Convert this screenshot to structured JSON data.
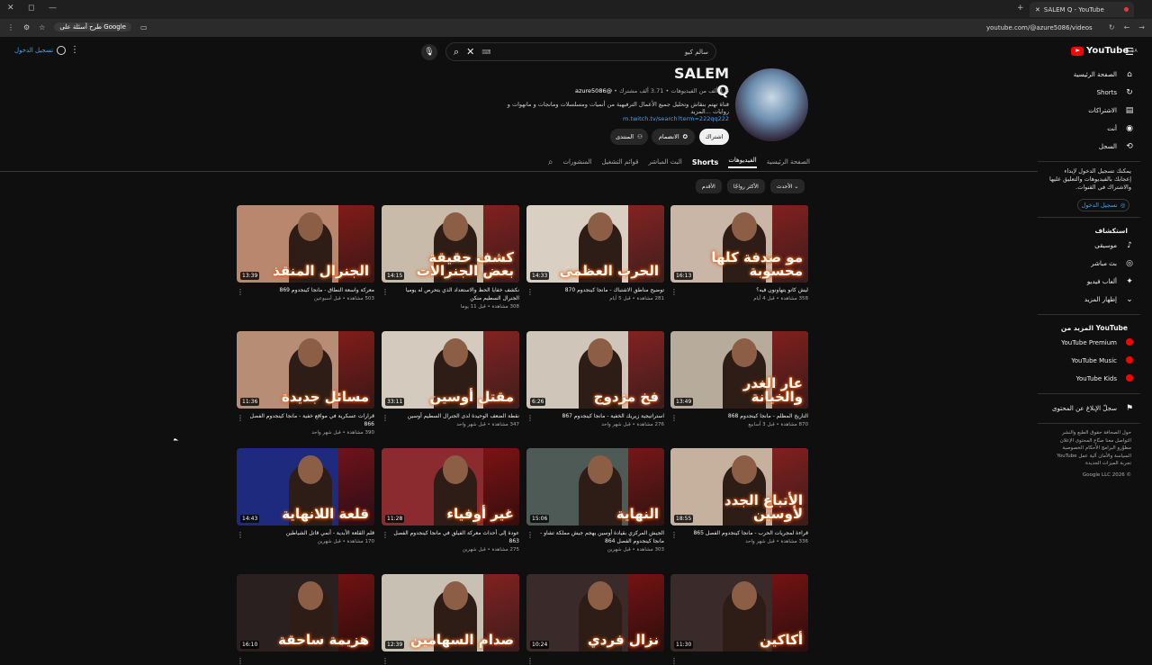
{
  "browser": {
    "tab_title": "SALEM Q - YouTube",
    "url": "youtube.com/@azure5086/videos",
    "ask_google_label": "طرح أسئلة على Google"
  },
  "header": {
    "signin_label": "تسجيل الدخول",
    "search_query": "سالم كيو",
    "logo_text": "YouTube",
    "logo_region": "SA"
  },
  "channel": {
    "name": "SALEM Q",
    "handle": "@azure5086",
    "subscribers": "3.71 ألف مشترك",
    "videos_count": "1.6 ألف من الفيديوهات",
    "description": "قناة تهتم بنقاش وتحليل جميع الأعمال الترفيهية من أنميات ومسلسلات ومانجات و مانهوات و روايات ...المزيد",
    "link": "m.twitch.tv/search?term=222qq222",
    "subscribe_label": "اشتراك",
    "join_label": "الانضمام",
    "community_label": "المنتدى"
  },
  "tabs": [
    "الصفحة الرئيسية",
    "الفيديوهات",
    "Shorts",
    "البث المباشر",
    "قوائم التشغيل",
    "المنشورات"
  ],
  "chips": [
    "الأحدث",
    "الأكثر رواجًا",
    "الأقدم"
  ],
  "sidebar": {
    "main": [
      {
        "label": "الصفحة الرئيسية",
        "icon": "⌂"
      },
      {
        "label": "Shorts",
        "icon": "↻"
      },
      {
        "label": "الاشتراكات",
        "icon": "▤"
      },
      {
        "label": "أنت",
        "icon": "◉"
      },
      {
        "label": "السجل",
        "icon": "⟲"
      }
    ],
    "signin_note": "يمكنك تسجيل الدخول لإبداء إعجابك بالفيديوهات والتعليق عليها والاشتراك في القنوات.",
    "signin_label": "تسجيل الدخول",
    "explore_title": "استكشاف",
    "explore": [
      {
        "label": "موسيقى",
        "icon": "♪"
      },
      {
        "label": "بث مباشر",
        "icon": "◎"
      },
      {
        "label": "ألعاب فيديو",
        "icon": "✦"
      },
      {
        "label": "إظهار المزيد",
        "icon": "⌄"
      }
    ],
    "more_title": "المزيد من YouTube",
    "more": [
      "YouTube Premium",
      "YouTube Music",
      "YouTube Kids"
    ],
    "report_label": "سجلّ الإبلاغ عن المحتوى",
    "footer": "حول   الصحافة   حقوق الطبع والنشر   التواصل معنا   صنّاع المحتوى   الإعلان   مطوّرو البرامج   الأحكام   الخصوصية   السياسة والأمان   آلية عمل YouTube   تجربة الميزات الجديدة",
    "copyright": "© 2026 Google LLC"
  },
  "videos": [
    {
      "overlay": "مو صدفة كلها محسوبة",
      "duration": "16:13",
      "title": "ليش كانو يتهاونون فيه؟",
      "stats": "358 مشاهدة • قبل 4 أيام",
      "bg": "#c9b6a6"
    },
    {
      "overlay": "الحرب العظمى",
      "duration": "14:33",
      "title": "توضيح مناطق الاشتباك - مانجا كينجدوم 870",
      "stats": "281 مشاهدة • قبل 5 أيام",
      "bg": "#d9cfc2"
    },
    {
      "overlay": "كشف حقيقة بعض الجنرالات",
      "duration": "14:15",
      "title": "نكشف خفايا الحظ والاستعداد الذي يتحرص له يوميا الجنرال السطيم منكن",
      "stats": "308 مشاهدة • قبل 11 يوما",
      "bg": "#c8bba9"
    },
    {
      "overlay": "الجنرال المنقذ",
      "duration": "13:39",
      "title": "معركة واسعة النطاق - مانجا كينجدوم 869",
      "stats": "503 مشاهدة • قبل أسبوعين",
      "bg": "#b9876e"
    },
    {
      "overlay": "عار الغدر والخيانة",
      "duration": "13:49",
      "title": "التاريخ المظلم - مانجا كينجدوم 868",
      "stats": "870 مشاهدة • قبل 3 أسابيع",
      "bg": "#b7ab9b"
    },
    {
      "overlay": "فخ مزدوج",
      "duration": "6:26",
      "title": "استراتيجية زيريك الخفية - مانجا كينجدوم 867",
      "stats": "276 مشاهدة • قبل شهر واحد",
      "bg": "#cfc5b8"
    },
    {
      "overlay": "مقتل أوسين",
      "duration": "33:11",
      "title": "نقطة الضعف الوحيدة لدى الجنرال السطيم أوسين",
      "stats": "347 مشاهدة • قبل شهر واحد",
      "bg": "#d4cabd"
    },
    {
      "overlay": "مسائل جديدة",
      "duration": "11:36",
      "title": "قرارات عسكرية في مواقع خفية - مانجا كينجدوم الفصل 866",
      "stats": "390 مشاهدة • قبل شهر واحد",
      "bg": "#b88d76"
    },
    {
      "overlay": "الأتباع الجدد لأوسين",
      "duration": "18:55",
      "title": "قراءة لمجريات الحرب - مانجا كينجدوم الفصل 865",
      "stats": "336 مشاهدة • قبل شهر واحد",
      "bg": "#c6b19f"
    },
    {
      "overlay": "النهاية",
      "duration": "15:06",
      "title": "الجيش المركزي بقيادة أوسين يهجم جيش مملكة تشاو - مانجا كينجدوم الفصل 864",
      "stats": "303 مشاهدة • قبل شهرين",
      "bg": "#4d5a56"
    },
    {
      "overlay": "غير أوفياء",
      "duration": "11:28",
      "title": "عودة إلى أحداث معركة الفيلق في مانجا كينجدوم الفصل 863",
      "stats": "275 مشاهدة • قبل شهرين",
      "bg": "#8c2b2f"
    },
    {
      "overlay": "قلعة اللانهاية",
      "duration": "14:43",
      "title": "قلم القلعة الأبدية - أنمي قاتل الشياطين",
      "stats": "170 مشاهدة • قبل شهرين",
      "bg": "#1d2a7d"
    },
    {
      "overlay": "أكاكين",
      "duration": "11:30",
      "title": "",
      "stats": "",
      "bg": "#3a2a2a"
    },
    {
      "overlay": "نزال فردي",
      "duration": "10:24",
      "title": "",
      "stats": "",
      "bg": "#3a2a2a"
    },
    {
      "overlay": "صدام السهامين",
      "duration": "12:39",
      "title": "",
      "stats": "",
      "bg": "#c9c0b4"
    },
    {
      "overlay": "هزيمة ساحقة",
      "duration": "16:10",
      "title": "",
      "stats": "",
      "bg": "#2a2020"
    }
  ]
}
